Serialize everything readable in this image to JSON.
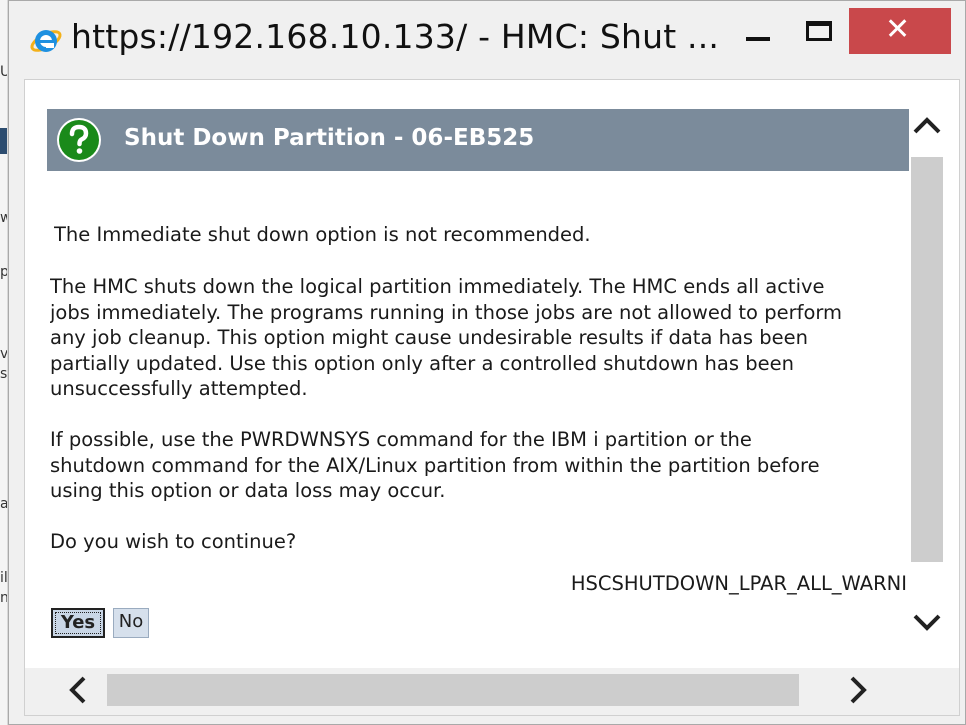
{
  "window": {
    "title": "https://192.168.10.133/ - HMC: Shut ...",
    "minimize_label": "—",
    "maximize_label": "☐",
    "close_label": "✕"
  },
  "background": {
    "fragments": [
      "U",
      "w",
      "p",
      "v",
      "s",
      "a",
      "il",
      "n"
    ]
  },
  "dialog": {
    "title": "Shut Down Partition - 06-EB525",
    "paragraphs": [
      [
        "The Immediate shut down option is not recommended."
      ],
      [
        "The HMC shuts down the logical partition immediately. The HMC ends all active",
        "jobs immediately. The programs running in those jobs are not allowed to perform",
        "any job cleanup. This option might cause undesirable results if data has been",
        "partially updated. Use this option only after a controlled shutdown has been",
        "unsuccessfully attempted."
      ],
      [
        "If possible, use the PWRDWNSYS command for the IBM i partition or the",
        "shutdown command for the AIX/Linux partition from within the partition before",
        "using this option or data loss may occur."
      ],
      [
        "Do you wish to continue?"
      ]
    ],
    "message_code": "HSCSHUTDOWN_LPAR_ALL_WARNI",
    "buttons": {
      "yes": "Yes",
      "no": "No"
    }
  },
  "icons": {
    "browser": "internet-explorer-icon",
    "dialog": "question-icon",
    "scroll_up": "chevron-up-icon",
    "scroll_down": "chevron-down-icon",
    "scroll_left": "chevron-left-icon",
    "scroll_right": "chevron-right-icon"
  },
  "colors": {
    "header_bar": "#7b8b9b",
    "close_button": "#c9484b",
    "question_icon": "#1a8a1a",
    "yes_button": "#c9d6e6"
  }
}
